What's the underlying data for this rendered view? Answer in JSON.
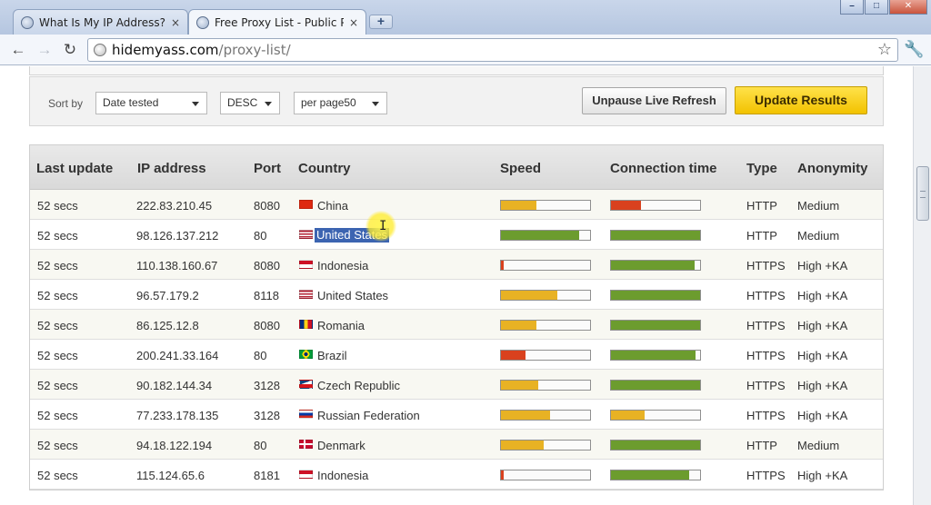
{
  "browser": {
    "tabs": [
      {
        "title": "What Is My IP Address? Loc",
        "close": "×"
      },
      {
        "title": "Free Proxy List - Public Prox",
        "close": "×"
      }
    ],
    "new_tab": "+",
    "window_controls": {
      "minimize": "–",
      "maximize": "□",
      "close": "✕"
    },
    "nav": {
      "back": "←",
      "forward": "→",
      "reload": "↻"
    },
    "url_host": "hidemyass.com",
    "url_path": "/proxy-list/",
    "star": "☆",
    "wrench": "🔧"
  },
  "controls": {
    "sort_label": "Sort by",
    "sort_field": "Date tested",
    "sort_order": "DESC",
    "per_page": "per page50",
    "unpause_label": "Unpause Live Refresh",
    "update_label": "Update Results"
  },
  "table": {
    "headers": [
      "Last update",
      "IP address",
      "Port",
      "Country",
      "Speed",
      "Connection time",
      "Type",
      "Anonymity"
    ],
    "rows": [
      {
        "last_update": "52 secs",
        "ip": "222.83.210.45",
        "port": "8080",
        "country": "China",
        "speed": 0.4,
        "speed_color": "#e8b224",
        "conn": 0.34,
        "conn_color": "#d9411e",
        "type": "HTTP",
        "anonymity": "Medium"
      },
      {
        "last_update": "52 secs",
        "ip": "98.126.137.212",
        "port": "80",
        "country": "United States",
        "speed": 0.88,
        "speed_color": "#6c9c2e",
        "conn": 1.0,
        "conn_color": "#6c9c2e",
        "type": "HTTP",
        "anonymity": "Medium"
      },
      {
        "last_update": "52 secs",
        "ip": "110.138.160.67",
        "port": "8080",
        "country": "Indonesia",
        "speed": 0.03,
        "speed_color": "#d9411e",
        "conn": 0.94,
        "conn_color": "#6c9c2e",
        "type": "HTTPS",
        "anonymity": "High +KA"
      },
      {
        "last_update": "52 secs",
        "ip": "96.57.179.2",
        "port": "8118",
        "country": "United States",
        "speed": 0.63,
        "speed_color": "#e8b224",
        "conn": 1.0,
        "conn_color": "#6c9c2e",
        "type": "HTTPS",
        "anonymity": "High +KA"
      },
      {
        "last_update": "52 secs",
        "ip": "86.125.12.8",
        "port": "8080",
        "country": "Romania",
        "speed": 0.4,
        "speed_color": "#e8b224",
        "conn": 1.0,
        "conn_color": "#6c9c2e",
        "type": "HTTPS",
        "anonymity": "High +KA"
      },
      {
        "last_update": "52 secs",
        "ip": "200.241.33.164",
        "port": "80",
        "country": "Brazil",
        "speed": 0.28,
        "speed_color": "#d9411e",
        "conn": 0.95,
        "conn_color": "#6c9c2e",
        "type": "HTTPS",
        "anonymity": "High +KA"
      },
      {
        "last_update": "52 secs",
        "ip": "90.182.144.34",
        "port": "3128",
        "country": "Czech Republic",
        "speed": 0.42,
        "speed_color": "#e8b224",
        "conn": 1.0,
        "conn_color": "#6c9c2e",
        "type": "HTTPS",
        "anonymity": "High +KA"
      },
      {
        "last_update": "52 secs",
        "ip": "77.233.178.135",
        "port": "3128",
        "country": "Russian Federation",
        "speed": 0.55,
        "speed_color": "#e8b224",
        "conn": 0.38,
        "conn_color": "#e8b224",
        "type": "HTTPS",
        "anonymity": "High +KA"
      },
      {
        "last_update": "52 secs",
        "ip": "94.18.122.194",
        "port": "80",
        "country": "Denmark",
        "speed": 0.48,
        "speed_color": "#e8b224",
        "conn": 1.0,
        "conn_color": "#6c9c2e",
        "type": "HTTP",
        "anonymity": "Medium"
      },
      {
        "last_update": "52 secs",
        "ip": "115.124.65.6",
        "port": "8181",
        "country": "Indonesia",
        "speed": 0.03,
        "speed_color": "#d9411e",
        "conn": 0.88,
        "conn_color": "#6c9c2e",
        "type": "HTTPS",
        "anonymity": "High +KA"
      }
    ]
  }
}
